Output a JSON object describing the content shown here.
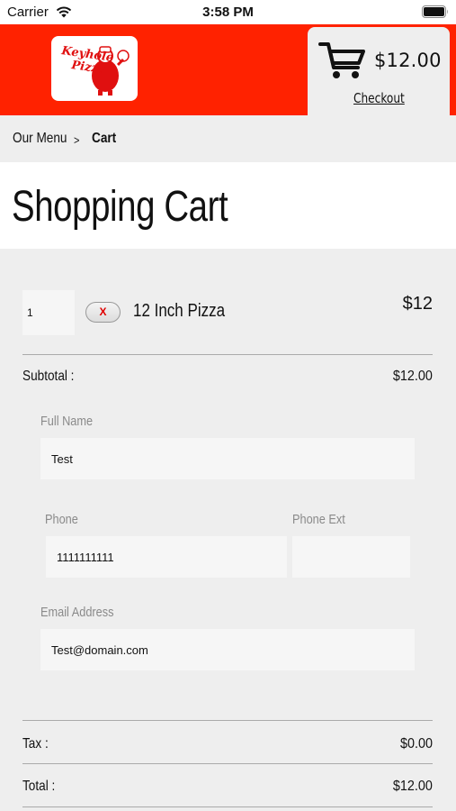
{
  "status_bar": {
    "carrier": "Carrier",
    "time": "3:58 PM",
    "wifi_icon": "wifi-icon",
    "battery_icon": "battery-icon"
  },
  "header": {
    "brand_color": "#ff2200",
    "logo_text": "Keyhole Pizza",
    "cart_icon": "shopping-cart-icon",
    "cart_total": "$12.00",
    "checkout_label": "Checkout"
  },
  "breadcrumb": {
    "home": "Our Menu",
    "separator": ">",
    "current": "Cart"
  },
  "page": {
    "title": "Shopping Cart"
  },
  "cart": {
    "items": [
      {
        "quantity": "1",
        "remove_label": "X",
        "name": "12 Inch Pizza",
        "price": "$12"
      }
    ],
    "subtotal_label": "Subtotal :",
    "subtotal_value": "$12.00",
    "tax_label": "Tax :",
    "tax_value": "$0.00",
    "total_label": "Total :",
    "total_value": "$12.00"
  },
  "form": {
    "full_name_label": "Full Name",
    "full_name_value": "Test",
    "phone_label": "Phone",
    "phone_value": "1111111111",
    "phone_ext_label": "Phone Ext",
    "phone_ext_value": "",
    "email_label": "Email Address",
    "email_value": "Test@domain.com"
  }
}
